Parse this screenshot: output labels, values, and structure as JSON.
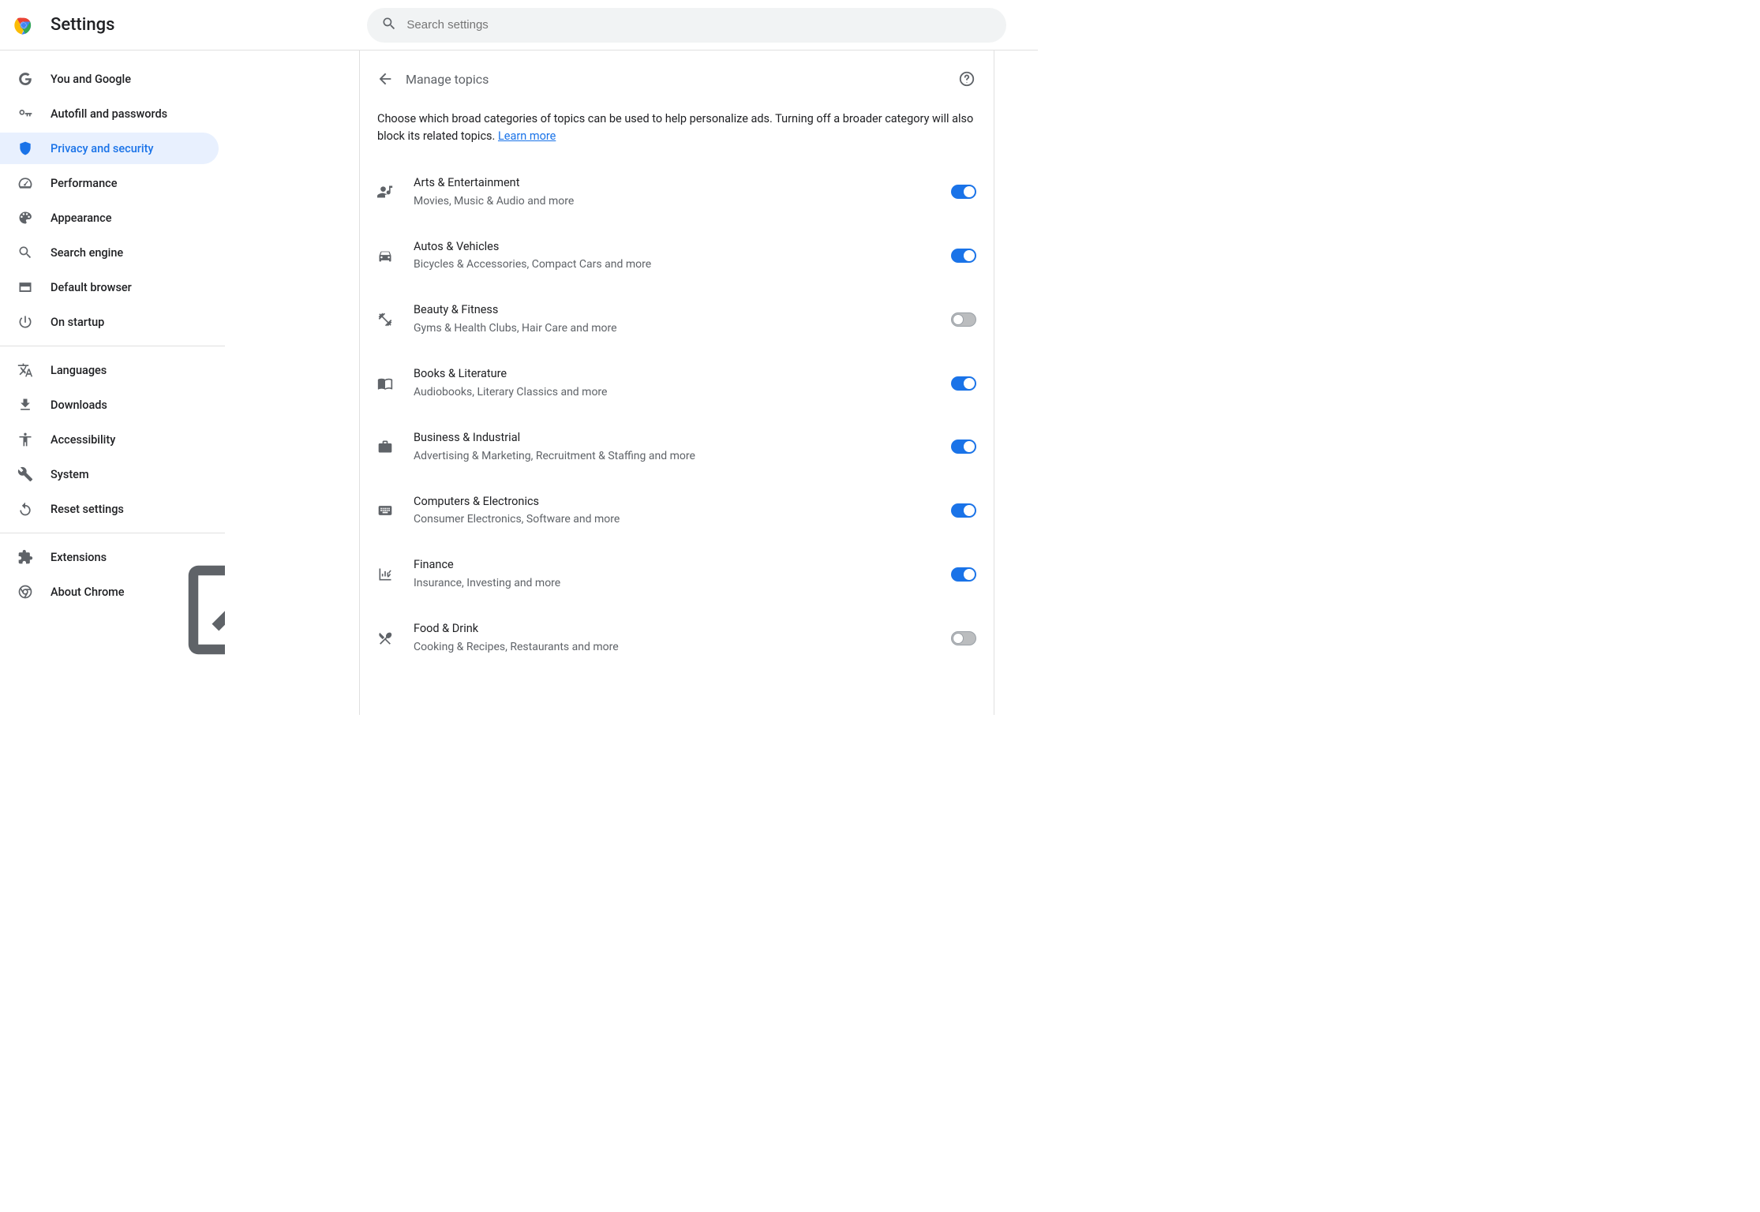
{
  "header": {
    "title": "Settings",
    "search_placeholder": "Search settings"
  },
  "sidebar": {
    "items": [
      {
        "id": "you-and-google",
        "label": "You and Google",
        "icon": "google"
      },
      {
        "id": "autofill",
        "label": "Autofill and passwords",
        "icon": "key"
      },
      {
        "id": "privacy",
        "label": "Privacy and security",
        "icon": "shield",
        "active": true
      },
      {
        "id": "performance",
        "label": "Performance",
        "icon": "speedometer"
      },
      {
        "id": "appearance",
        "label": "Appearance",
        "icon": "palette"
      },
      {
        "id": "search-engine",
        "label": "Search engine",
        "icon": "search"
      },
      {
        "id": "default-browser",
        "label": "Default browser",
        "icon": "browser"
      },
      {
        "id": "on-startup",
        "label": "On startup",
        "icon": "power"
      }
    ],
    "items2": [
      {
        "id": "languages",
        "label": "Languages",
        "icon": "translate"
      },
      {
        "id": "downloads",
        "label": "Downloads",
        "icon": "download"
      },
      {
        "id": "accessibility",
        "label": "Accessibility",
        "icon": "accessibility"
      },
      {
        "id": "system",
        "label": "System",
        "icon": "wrench"
      },
      {
        "id": "reset",
        "label": "Reset settings",
        "icon": "reset"
      }
    ],
    "items3": [
      {
        "id": "extensions",
        "label": "Extensions",
        "icon": "extension",
        "external": true
      },
      {
        "id": "about",
        "label": "About Chrome",
        "icon": "chrome"
      }
    ]
  },
  "page": {
    "title": "Manage topics",
    "intro": "Choose which broad categories of topics can be used to help personalize ads. Turning off a broader category will also block its related topics. ",
    "learn_more": "Learn more",
    "topics": [
      {
        "title": "Arts & Entertainment",
        "sub": "Movies, Music & Audio and more",
        "icon": "person-music",
        "on": true
      },
      {
        "title": "Autos & Vehicles",
        "sub": "Bicycles & Accessories, Compact Cars and more",
        "icon": "car",
        "on": true
      },
      {
        "title": "Beauty & Fitness",
        "sub": "Gyms & Health Clubs, Hair Care and more",
        "icon": "fitness",
        "on": false
      },
      {
        "title": "Books & Literature",
        "sub": "Audiobooks, Literary Classics and more",
        "icon": "book",
        "on": true
      },
      {
        "title": "Business & Industrial",
        "sub": "Advertising & Marketing, Recruitment & Staffing and more",
        "icon": "briefcase",
        "on": true
      },
      {
        "title": "Computers & Electronics",
        "sub": "Consumer Electronics, Software and more",
        "icon": "keyboard",
        "on": true
      },
      {
        "title": "Finance",
        "sub": "Insurance, Investing and more",
        "icon": "chart",
        "on": true
      },
      {
        "title": "Food & Drink",
        "sub": "Cooking & Recipes, Restaurants and more",
        "icon": "food",
        "on": false
      }
    ]
  }
}
